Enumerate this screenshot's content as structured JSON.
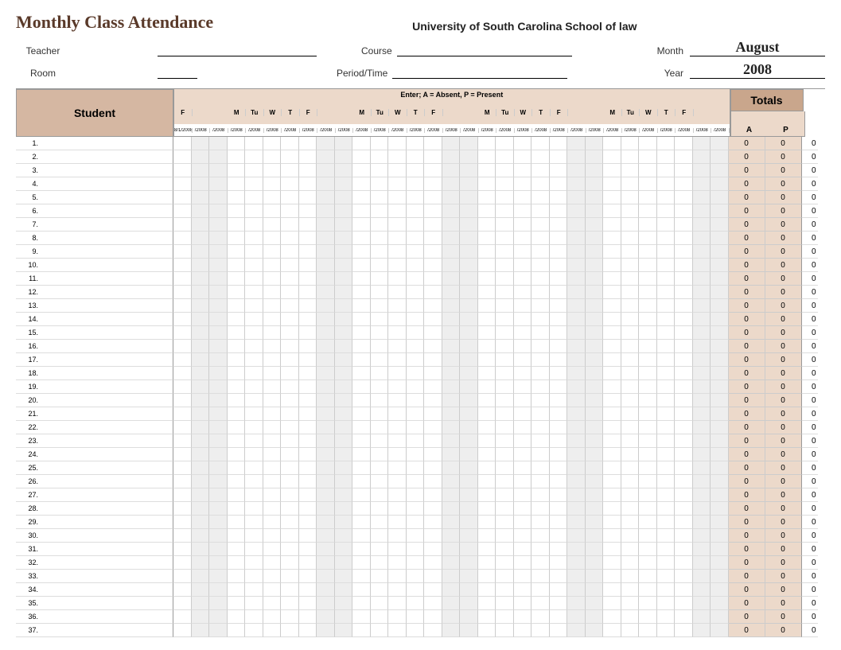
{
  "title": "Monthly Class Attendance",
  "subtitle": "University of South Carolina School of law",
  "labels": {
    "teacher": "Teacher",
    "course": "Course",
    "month": "Month",
    "room": "Room",
    "period": "Period/Time",
    "year": "Year"
  },
  "values": {
    "month": "August",
    "year": "2008"
  },
  "instruction": "Enter; A = Absent, P = Present",
  "studentHeader": "Student",
  "totalsHeader": "Totals",
  "apLabels": {
    "a": "A",
    "p": "P"
  },
  "days": [
    {
      "dow": "F",
      "date": "8/1/2008",
      "we": false
    },
    {
      "dow": "",
      "date": "/2008",
      "we": true
    },
    {
      "dow": "",
      "date": "/2008",
      "we": true
    },
    {
      "dow": "M",
      "date": "/2008",
      "we": false
    },
    {
      "dow": "Tu",
      "date": "/2008",
      "we": false
    },
    {
      "dow": "W",
      "date": "/2008",
      "we": false
    },
    {
      "dow": "T",
      "date": "/2008",
      "we": false
    },
    {
      "dow": "F",
      "date": "/2008",
      "we": false
    },
    {
      "dow": "",
      "date": "/2008",
      "we": true
    },
    {
      "dow": "",
      "date": "/2008",
      "we": true
    },
    {
      "dow": "M",
      "date": "/2008",
      "we": false
    },
    {
      "dow": "Tu",
      "date": "/2008",
      "we": false
    },
    {
      "dow": "W",
      "date": "/2008",
      "we": false
    },
    {
      "dow": "T",
      "date": "/2008",
      "we": false
    },
    {
      "dow": "F",
      "date": "/2008",
      "we": false
    },
    {
      "dow": "",
      "date": "/2008",
      "we": true
    },
    {
      "dow": "",
      "date": "/2008",
      "we": true
    },
    {
      "dow": "M",
      "date": "/2008",
      "we": false
    },
    {
      "dow": "Tu",
      "date": "/2008",
      "we": false
    },
    {
      "dow": "W",
      "date": "/2008",
      "we": false
    },
    {
      "dow": "T",
      "date": "/2008",
      "we": false
    },
    {
      "dow": "F",
      "date": "/2008",
      "we": false
    },
    {
      "dow": "",
      "date": "/2008",
      "we": true
    },
    {
      "dow": "",
      "date": "/2008",
      "we": true
    },
    {
      "dow": "M",
      "date": "/2008",
      "we": false
    },
    {
      "dow": "Tu",
      "date": "/2008",
      "we": false
    },
    {
      "dow": "W",
      "date": "/2008",
      "we": false
    },
    {
      "dow": "T",
      "date": "/2008",
      "we": false
    },
    {
      "dow": "F",
      "date": "/2008",
      "we": false
    },
    {
      "dow": "",
      "date": "/2008",
      "we": true
    },
    {
      "dow": "",
      "date": "/2008",
      "we": true
    }
  ],
  "rowCount": 37,
  "zeroA": "0",
  "zeroP": "0",
  "zeroExt": "0"
}
